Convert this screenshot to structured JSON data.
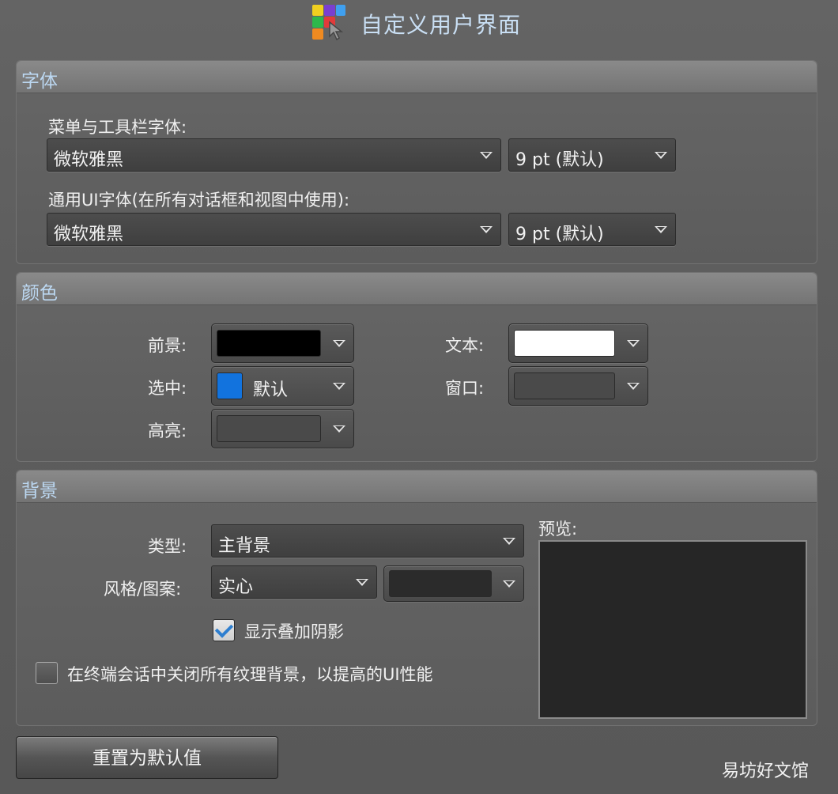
{
  "window": {
    "title": "自定义用户界面",
    "logo_icon": "customize-ui-logo-icon"
  },
  "font_group": {
    "title": "字体",
    "menu_toolbar_label": "菜单与工具栏字体:",
    "menu_font": "微软雅黑",
    "menu_size": "9 pt (默认)",
    "general_label": "通用UI字体(在所有对话框和视图中使用):",
    "general_font": "微软雅黑",
    "general_size": "9 pt (默认)"
  },
  "color_group": {
    "title": "颜色",
    "foreground_label": "前景:",
    "foreground_color": "#000000",
    "selected_label": "选中:",
    "selected_color": "#1273de",
    "selected_value": "默认",
    "highlight_label": "高亮:",
    "highlight_color": "#4a4a4a",
    "text_label": "文本:",
    "text_color": "#ffffff",
    "window_label": "窗口:",
    "window_color": "#4a4a4a"
  },
  "background_group": {
    "title": "背景",
    "type_label": "类型:",
    "type_value": "主背景",
    "style_label": "风格/图案:",
    "style_value": "实心",
    "style_color": "#2b2b2b",
    "show_shadow_label": "显示叠加阴影",
    "show_shadow_checked": true,
    "disable_texture_label": "在终端会话中关闭所有纹理背景，以提高的UI性能",
    "disable_texture_checked": false,
    "preview_label": "预览:",
    "preview_color": "#262626"
  },
  "buttons": {
    "reset_label": "重置为默认值"
  },
  "watermark": "易坊好文馆"
}
